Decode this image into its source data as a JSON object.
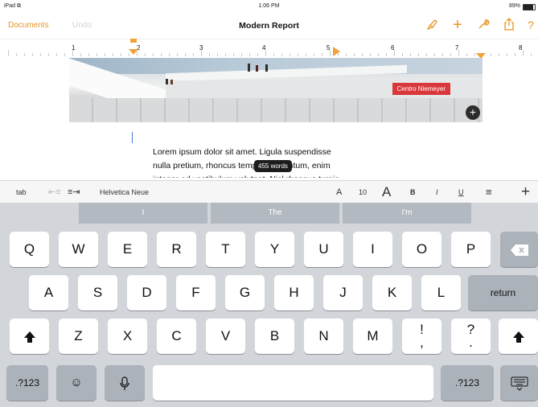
{
  "status": {
    "device": "iPad",
    "wifi": "⧉",
    "time": "1:06 PM",
    "battery": "89%"
  },
  "nav": {
    "documents_label": "Documents",
    "undo_label": "Undo",
    "title": "Modern Report",
    "icons": [
      "paintbrush-icon",
      "plus-icon",
      "wrench-icon",
      "share-icon",
      "help-icon"
    ],
    "accent": "#e9951f"
  },
  "ruler": {
    "numbers": [
      "1",
      "2",
      "3",
      "4",
      "5",
      "6",
      "7",
      "8"
    ]
  },
  "image": {
    "caption_badge": "Centro Niemeyer",
    "badge_color": "#d9373a"
  },
  "document": {
    "lines": [
      "Lorem ipsum dolor sit amet. Ligula suspendisse",
      "nulla pretium, rhoncus tempor fermentum, enim",
      "integer ad vestibulum volutpat. Nisl rhoncus turpis"
    ],
    "word_count": "455 words"
  },
  "format_bar": {
    "tab_label": "tab",
    "font_name": "Helvetica Neue",
    "font_size": "10",
    "small_a": "A",
    "big_a": "A",
    "bold": "B",
    "italic": "I",
    "underline": "U",
    "plus": "+"
  },
  "predictions": [
    "I",
    "The",
    "I'm"
  ],
  "keyboard": {
    "row1": [
      "Q",
      "W",
      "E",
      "R",
      "T",
      "Y",
      "U",
      "I",
      "O",
      "P"
    ],
    "row2": [
      "A",
      "S",
      "D",
      "F",
      "G",
      "H",
      "J",
      "K",
      "L"
    ],
    "row3": [
      "Z",
      "X",
      "C",
      "V",
      "B",
      "N",
      "M",
      "!",
      "?"
    ],
    "row3_sub": [
      ",",
      "."
    ],
    "return_label": "return",
    "numbers_label": ".?123",
    "space_label": ""
  }
}
